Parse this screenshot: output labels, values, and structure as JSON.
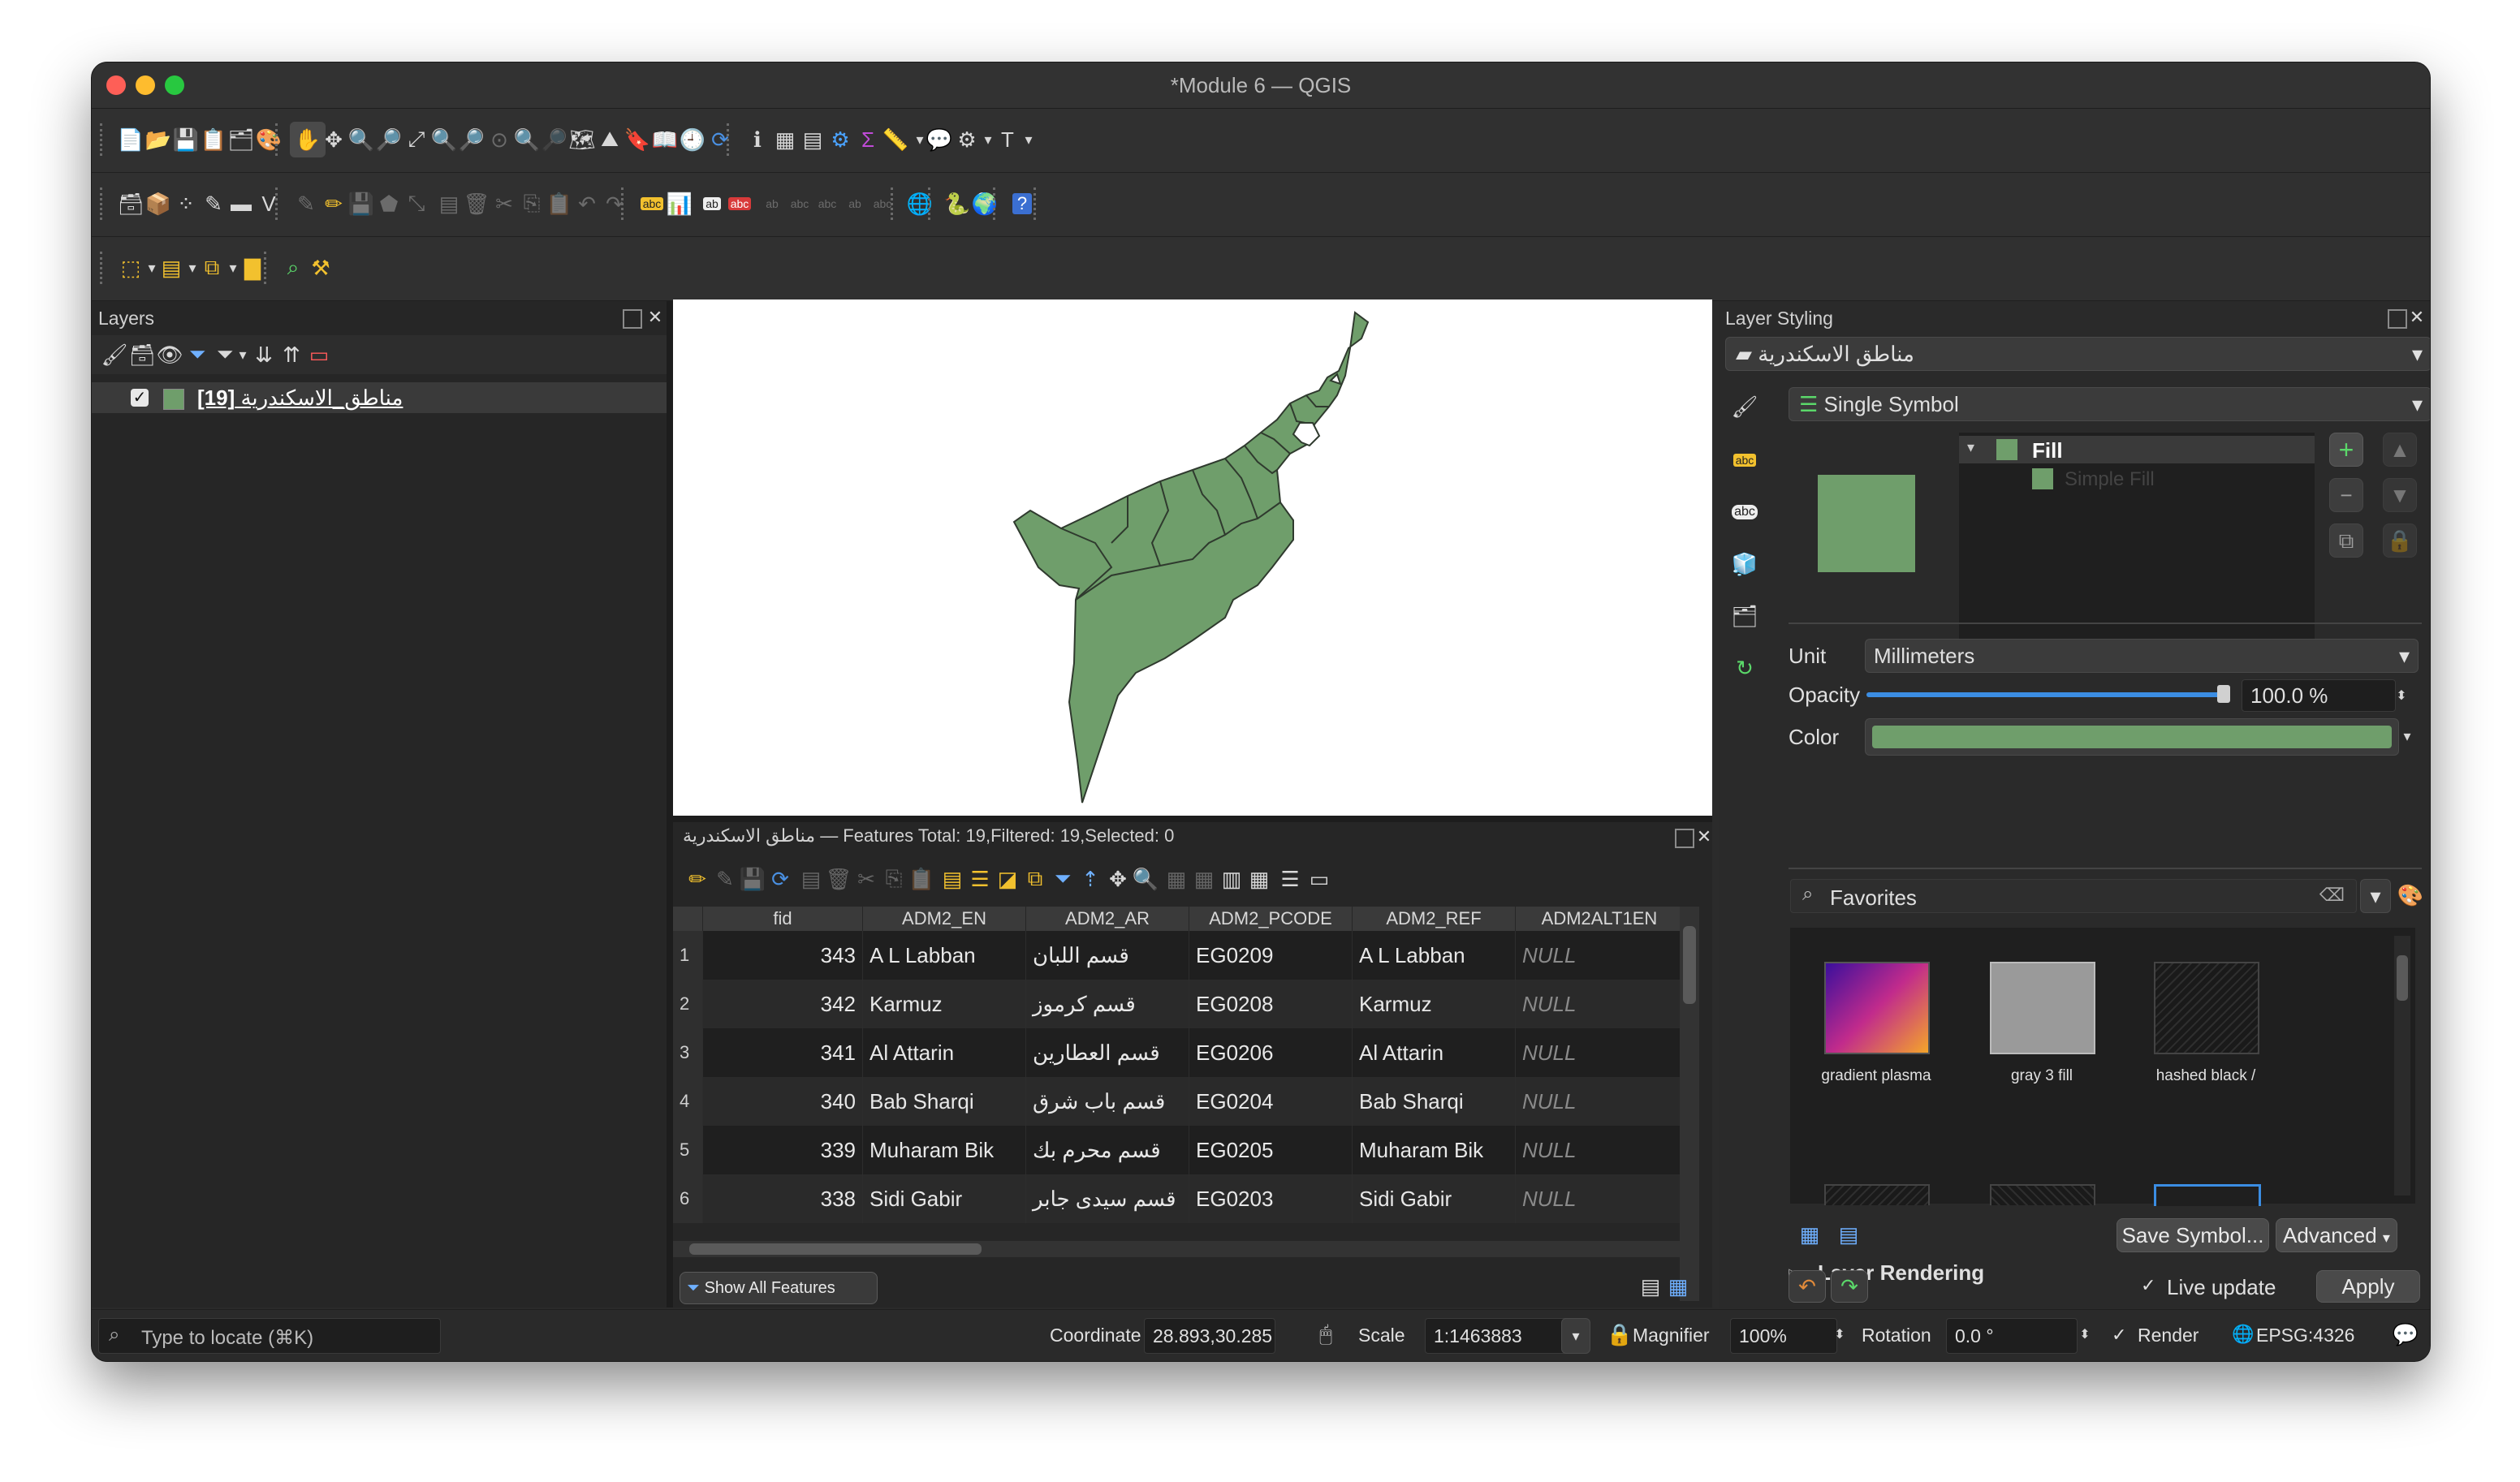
{
  "window": {
    "title": "*Module 6 — QGIS"
  },
  "layers_panel": {
    "title": "Layers",
    "layer": {
      "count_label": "[19]",
      "name": "مناطق_الاسكندرية"
    }
  },
  "attribute_table": {
    "header": "مناطق الاسكندرية — Features Total: 19,Filtered: 19,Selected: 0",
    "columns": [
      "fid",
      "ADM2_EN",
      "ADM2_AR",
      "ADM2_PCODE",
      "ADM2_REF",
      "ADM2ALT1EN"
    ],
    "rows": [
      {
        "n": "1",
        "fid": "343",
        "en": "A L Labban",
        "ar": "قسم اللبان",
        "pcode": "EG0209",
        "ref": "A L Labban",
        "alt": "NULL"
      },
      {
        "n": "2",
        "fid": "342",
        "en": "Karmuz",
        "ar": "قسم كرموز",
        "pcode": "EG0208",
        "ref": "Karmuz",
        "alt": "NULL"
      },
      {
        "n": "3",
        "fid": "341",
        "en": "Al Attarin",
        "ar": "قسم العطارين",
        "pcode": "EG0206",
        "ref": "Al Attarin",
        "alt": "NULL"
      },
      {
        "n": "4",
        "fid": "340",
        "en": "Bab Sharqi",
        "ar": "قسم باب شرق",
        "pcode": "EG0204",
        "ref": "Bab Sharqi",
        "alt": "NULL"
      },
      {
        "n": "5",
        "fid": "339",
        "en": "Muharam Bik",
        "ar": "قسم محرم بك",
        "pcode": "EG0205",
        "ref": "Muharam Bik",
        "alt": "NULL"
      },
      {
        "n": "6",
        "fid": "338",
        "en": "Sidi Gabir",
        "ar": "قسم سيدى جابر",
        "pcode": "EG0203",
        "ref": "Sidi Gabir",
        "alt": "NULL"
      }
    ],
    "show_all": "Show All Features"
  },
  "styling": {
    "title": "Layer Styling",
    "layer_select": "مناطق الاسكندرية",
    "renderer": "Single Symbol",
    "tree_fill": "Fill",
    "tree_simple": "Simple Fill",
    "unit_label": "Unit",
    "unit_value": "Millimeters",
    "opacity_label": "Opacity",
    "opacity_value": "100.0 %",
    "opacity_fraction": 1.0,
    "color_label": "Color",
    "fill_color": "#6f9e6b",
    "search_placeholder": "Favorites",
    "symbols": [
      {
        "label": "gradient   plasma"
      },
      {
        "label": "gray 3 fill"
      },
      {
        "label": "hashed black /"
      }
    ],
    "save_symbol": "Save Symbol...",
    "advanced": "Advanced",
    "layer_rendering": "Layer Rendering",
    "live_update": "Live update",
    "apply": "Apply"
  },
  "statusbar": {
    "locate_placeholder": "Type to locate (⌘K)",
    "coordinate_label": "Coordinate",
    "coordinate_value": "28.893,30.285",
    "scale_label": "Scale",
    "scale_value": "1:1463883",
    "magnifier_label": "Magnifier",
    "magnifier_value": "100%",
    "rotation_label": "Rotation",
    "rotation_value": "0.0 °",
    "render_label": "Render",
    "crs": "EPSG:4326"
  }
}
